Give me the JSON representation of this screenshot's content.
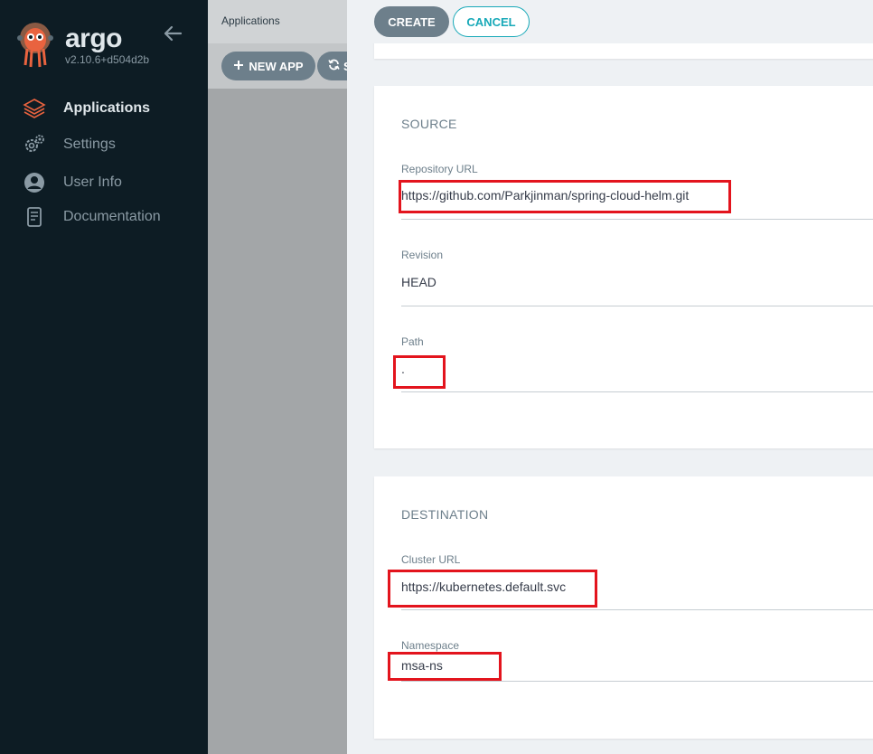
{
  "sidebar": {
    "brand": "argo",
    "version": "v2.10.6+d504d2b",
    "items": [
      {
        "label": "Applications",
        "icon": "layers-icon",
        "active": true
      },
      {
        "label": "Settings",
        "icon": "gears-icon"
      },
      {
        "label": "User Info",
        "icon": "user-icon"
      },
      {
        "label": "Documentation",
        "icon": "book-icon"
      }
    ]
  },
  "background": {
    "title": "Applications",
    "new_app_label": "NEW APP",
    "sync_label": "S"
  },
  "panel": {
    "create_label": "CREATE",
    "cancel_label": "CANCEL",
    "source": {
      "title": "SOURCE",
      "repo_url_label": "Repository URL",
      "repo_url_value": "https://github.com/Parkjinman/spring-cloud-helm.git",
      "revision_label": "Revision",
      "revision_value": "HEAD",
      "path_label": "Path",
      "path_value": "."
    },
    "destination": {
      "title": "DESTINATION",
      "cluster_url_label": "Cluster URL",
      "cluster_url_value": "https://kubernetes.default.svc",
      "namespace_label": "Namespace",
      "namespace_value": "msa-ns"
    }
  },
  "colors": {
    "sidebar_bg": "#0d1c24",
    "accent": "#18a9b8",
    "button_gray": "#6d7f8b",
    "highlight_red": "#e3141d",
    "active_icon": "#e9633f"
  }
}
